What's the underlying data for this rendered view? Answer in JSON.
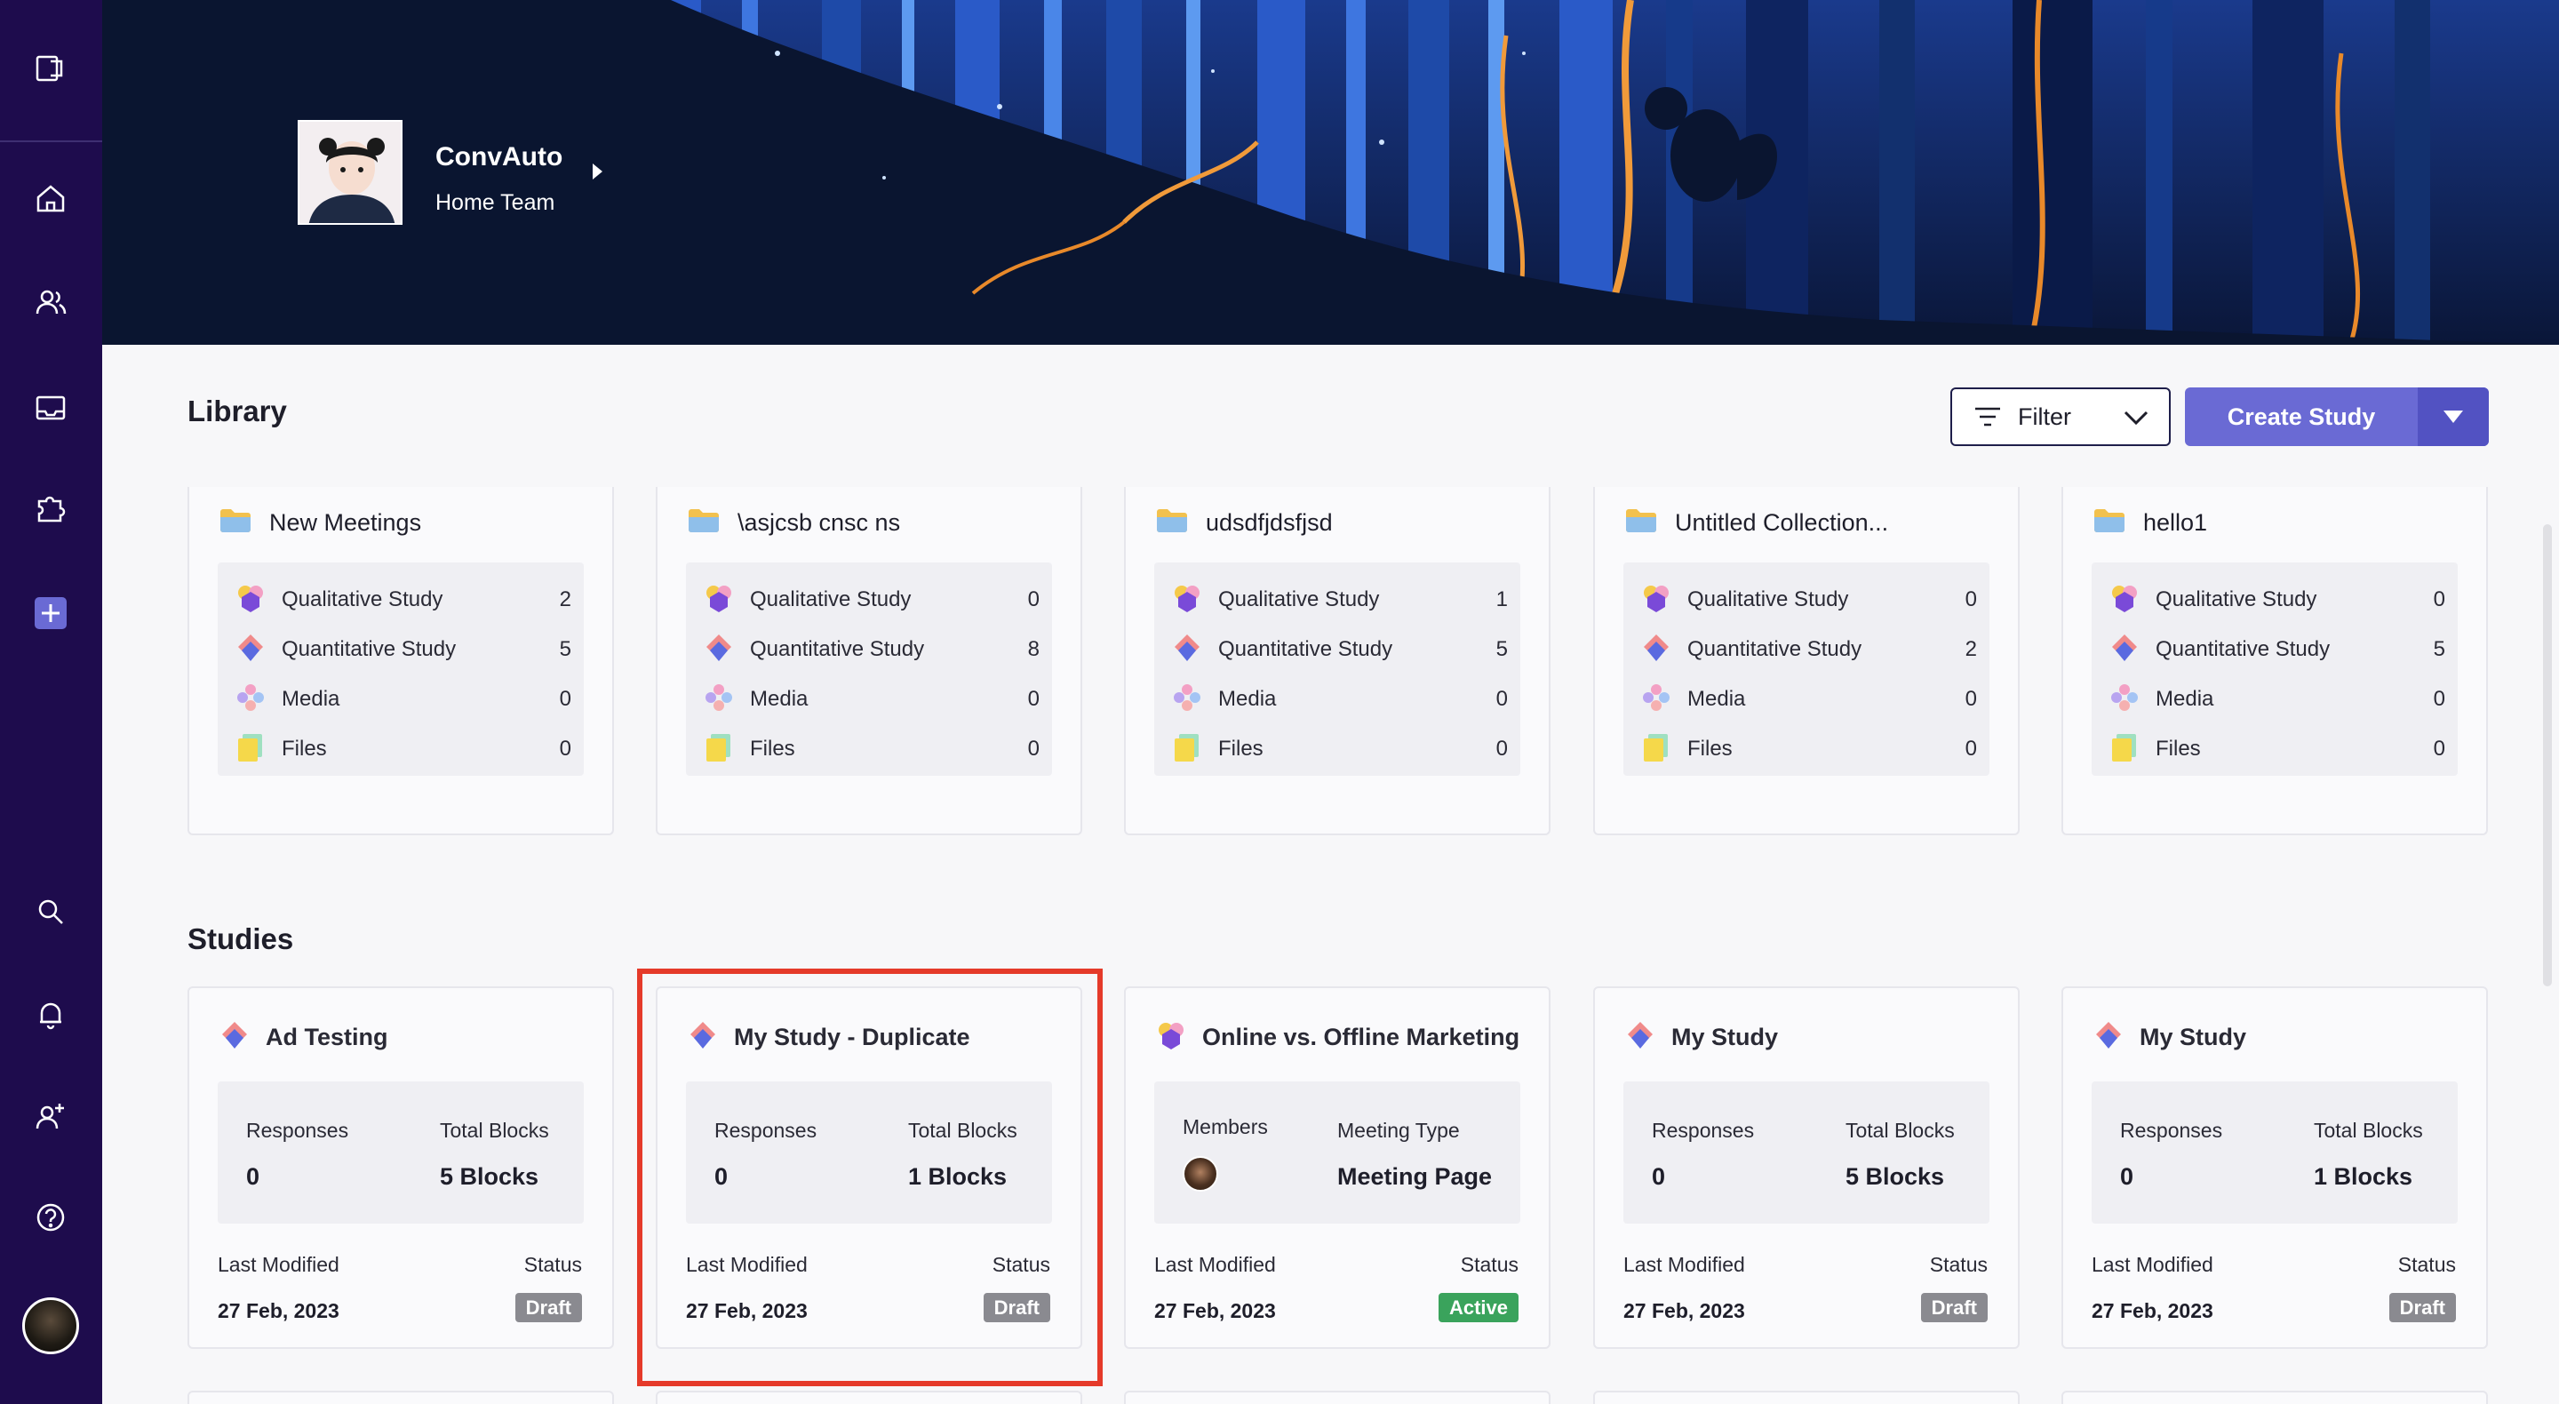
{
  "profile": {
    "name": "ConvAuto",
    "team": "Home Team"
  },
  "library": {
    "title": "Library",
    "filter_label": "Filter",
    "create_label": "Create Study",
    "collections": [
      {
        "name": "New Meetings",
        "items": [
          {
            "label": "Qualitative Study",
            "count": "2"
          },
          {
            "label": "Quantitative Study",
            "count": "5"
          },
          {
            "label": "Media",
            "count": "0"
          },
          {
            "label": "Files",
            "count": "0"
          }
        ]
      },
      {
        "name": "\\asjcsb cnsc ns",
        "items": [
          {
            "label": "Qualitative Study",
            "count": "0"
          },
          {
            "label": "Quantitative Study",
            "count": "8"
          },
          {
            "label": "Media",
            "count": "0"
          },
          {
            "label": "Files",
            "count": "0"
          }
        ]
      },
      {
        "name": "udsdfjdsfjsd",
        "items": [
          {
            "label": "Qualitative Study",
            "count": "1"
          },
          {
            "label": "Quantitative Study",
            "count": "5"
          },
          {
            "label": "Media",
            "count": "0"
          },
          {
            "label": "Files",
            "count": "0"
          }
        ]
      },
      {
        "name": "Untitled Collection...",
        "items": [
          {
            "label": "Qualitative Study",
            "count": "0"
          },
          {
            "label": "Quantitative Study",
            "count": "2"
          },
          {
            "label": "Media",
            "count": "0"
          },
          {
            "label": "Files",
            "count": "0"
          }
        ]
      },
      {
        "name": "hello1",
        "items": [
          {
            "label": "Qualitative Study",
            "count": "0"
          },
          {
            "label": "Quantitative Study",
            "count": "5"
          },
          {
            "label": "Media",
            "count": "0"
          },
          {
            "label": "Files",
            "count": "0"
          }
        ]
      }
    ]
  },
  "studies": {
    "title": "Studies",
    "cards": [
      {
        "name": "Ad Testing",
        "icon": "quantitative-icon",
        "kind": "study",
        "left_label": "Responses",
        "left_value": "0",
        "right_label": "Total Blocks",
        "right_value": "5 Blocks",
        "modified_label": "Last Modified",
        "modified": "27 Feb, 2023",
        "status_label": "Status",
        "status": "Draft"
      },
      {
        "name": "My Study - Duplicate",
        "icon": "quantitative-icon",
        "kind": "study",
        "left_label": "Responses",
        "left_value": "0",
        "right_label": "Total Blocks",
        "right_value": "1 Blocks",
        "modified_label": "Last Modified",
        "modified": "27 Feb, 2023",
        "status_label": "Status",
        "status": "Draft"
      },
      {
        "name": "Online vs. Offline Marketing",
        "icon": "qualitative-icon",
        "kind": "meeting",
        "left_label": "Members",
        "left_value": "",
        "right_label": "Meeting Type",
        "right_value": "Meeting Page",
        "modified_label": "Last Modified",
        "modified": "27 Feb, 2023",
        "status_label": "Status",
        "status": "Active"
      },
      {
        "name": "My Study",
        "icon": "quantitative-icon",
        "kind": "study",
        "left_label": "Responses",
        "left_value": "0",
        "right_label": "Total Blocks",
        "right_value": "5 Blocks",
        "modified_label": "Last Modified",
        "modified": "27 Feb, 2023",
        "status_label": "Status",
        "status": "Draft"
      },
      {
        "name": "My Study",
        "icon": "quantitative-icon",
        "kind": "study",
        "left_label": "Responses",
        "left_value": "0",
        "right_label": "Total Blocks",
        "right_value": "1 Blocks",
        "modified_label": "Last Modified",
        "modified": "27 Feb, 2023",
        "status_label": "Status",
        "status": "Draft"
      }
    ]
  },
  "colors": {
    "sidebar": "#1e0c4d",
    "accent": "#6a6ad4",
    "draft": "#8a8a90",
    "active": "#3aa35c",
    "highlight": "#e53a2a"
  },
  "sidebar_icons": [
    "collapse-icon",
    "home-icon",
    "users-icon",
    "inbox-icon",
    "puzzle-icon",
    "add-icon",
    "search-icon",
    "bell-icon",
    "add-user-icon",
    "help-icon"
  ]
}
